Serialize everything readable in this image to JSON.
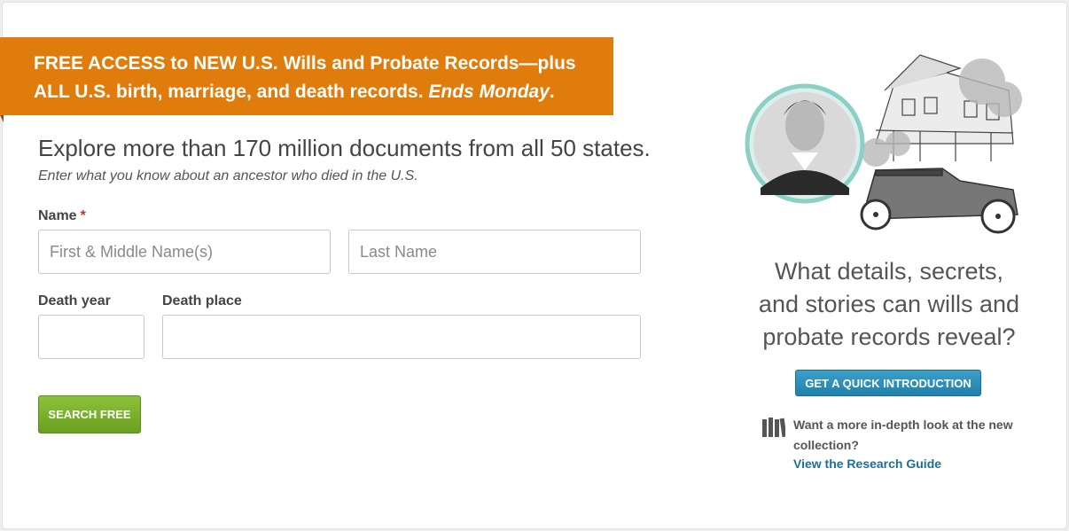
{
  "banner": {
    "line1": "FREE ACCESS to NEW U.S. Wills and Probate Records—plus",
    "line2": "ALL U.S. birth, marriage, and death records.",
    "ends": "Ends Monday",
    "period": "."
  },
  "form": {
    "headline": "Explore more than 170 million documents from all 50 states.",
    "subline": "Enter what you know about an ancestor who died in the U.S.",
    "name_label": "Name",
    "required_mark": "*",
    "first_name_placeholder": "First & Middle Name(s)",
    "last_name_placeholder": "Last Name",
    "death_year_label": "Death year",
    "death_place_label": "Death place",
    "search_button": "SEARCH FREE"
  },
  "sidebar": {
    "question_line1": "What details, secrets,",
    "question_line2": "and stories can wills and",
    "question_line3": "probate records reveal?",
    "intro_button": "GET A QUICK INTRODUCTION",
    "guide_text": "Want a more in-depth look at the new collection?",
    "guide_link": "View the Research Guide",
    "guide_icon": "books-icon"
  },
  "colors": {
    "banner": "#e07c0c",
    "search_button": "#7bb12d",
    "intro_button": "#2b8fba",
    "link": "#1f6f94"
  }
}
